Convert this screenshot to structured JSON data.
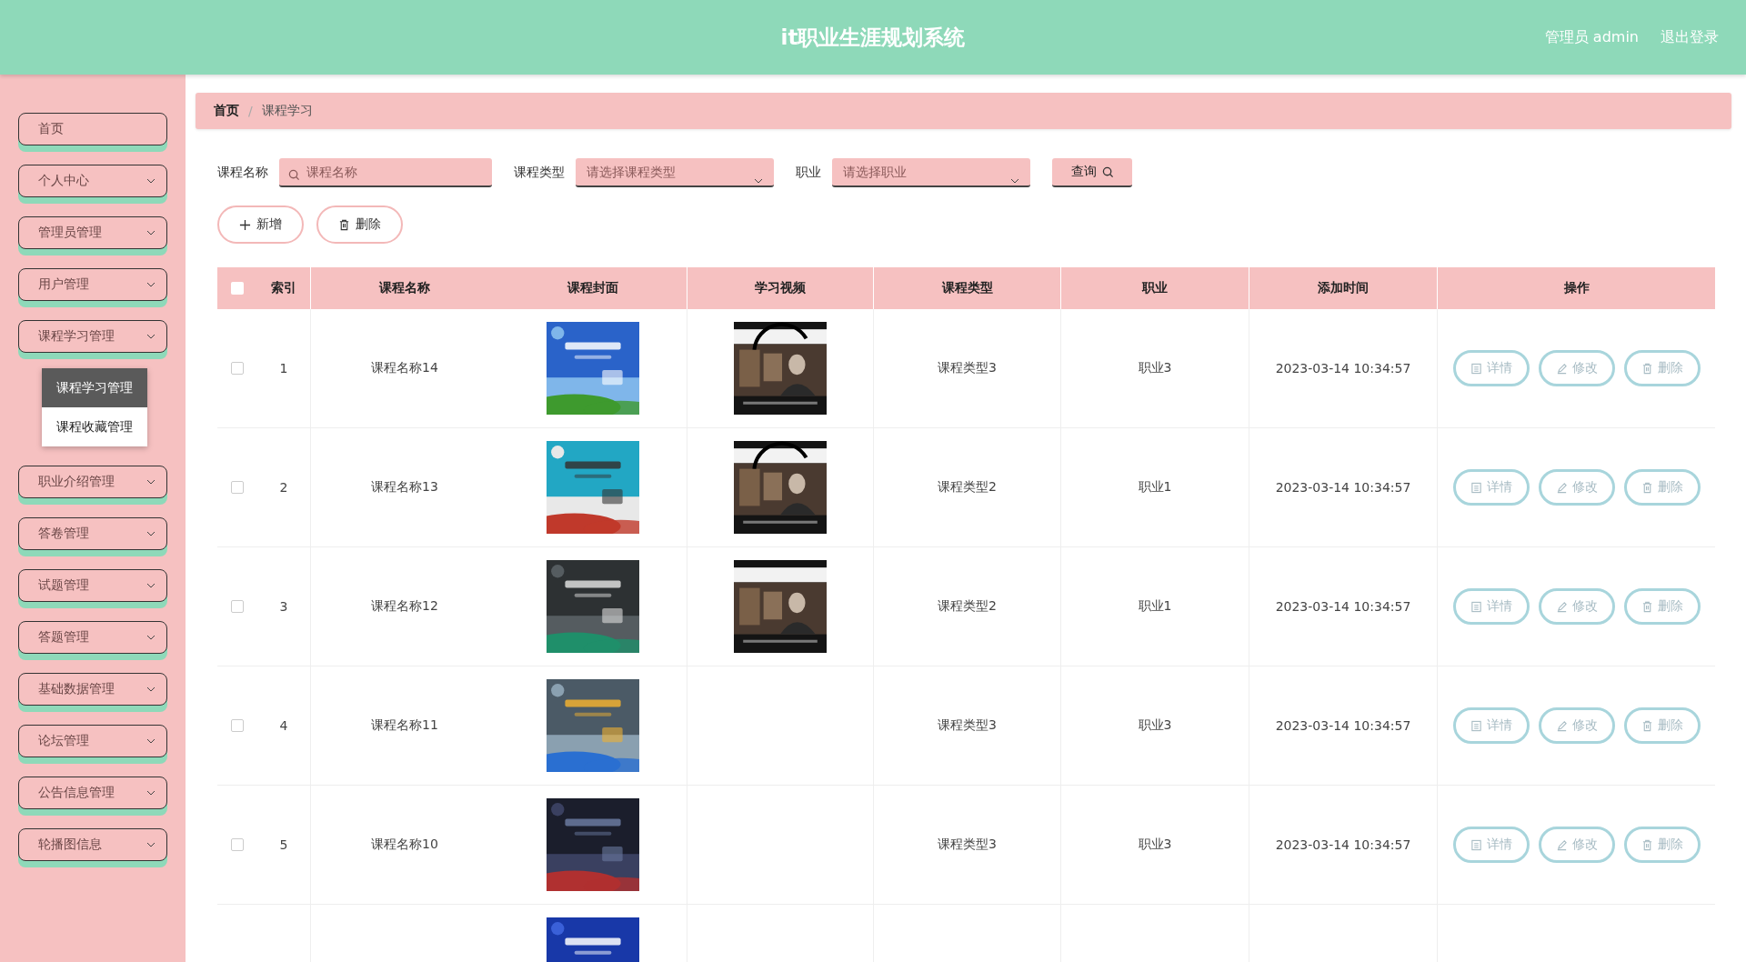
{
  "header": {
    "title": "it职业生涯规划系统",
    "user": "管理员 admin",
    "logout": "退出登录"
  },
  "sidebar": {
    "items": [
      {
        "label": "首页",
        "kind": "link"
      },
      {
        "label": "个人中心",
        "kind": "menu"
      },
      {
        "label": "管理员管理",
        "kind": "menu"
      },
      {
        "label": "用户管理",
        "kind": "menu"
      },
      {
        "label": "课程学习管理",
        "kind": "menu",
        "children": [
          {
            "label": "课程学习管理",
            "selected": true
          },
          {
            "label": "课程收藏管理",
            "selected": false
          }
        ]
      },
      {
        "label": "职业介绍管理",
        "kind": "menu"
      },
      {
        "label": "答卷管理",
        "kind": "menu"
      },
      {
        "label": "试题管理",
        "kind": "menu"
      },
      {
        "label": "答题管理",
        "kind": "menu"
      },
      {
        "label": "基础数据管理",
        "kind": "menu"
      },
      {
        "label": "论坛管理",
        "kind": "menu"
      },
      {
        "label": "公告信息管理",
        "kind": "menu"
      },
      {
        "label": "轮播图信息",
        "kind": "menu"
      }
    ]
  },
  "breadcrumb": {
    "separator": "/",
    "items": [
      {
        "label": "首页"
      },
      {
        "label": "课程学习"
      }
    ]
  },
  "search": {
    "fields": [
      {
        "label": "课程名称",
        "kind": "input",
        "placeholder": "课程名称"
      },
      {
        "label": "课程类型",
        "kind": "select",
        "placeholder": "请选择课程类型"
      },
      {
        "label": "职业",
        "kind": "select",
        "placeholder": "请选择职业"
      }
    ],
    "button": "查询"
  },
  "actions": [
    {
      "label": "新增",
      "kind": "add"
    },
    {
      "label": "删除",
      "kind": "delete"
    }
  ],
  "table": {
    "all_checked": false,
    "columns": [
      "索引",
      "课程名称",
      "课程封面",
      "学习视频",
      "课程类型",
      "职业",
      "添加时间",
      "操作"
    ],
    "rows": [
      {
        "checked": false,
        "index": "1",
        "name": "课程名称14",
        "cover": {
          "kind": "picture"
        },
        "video": {
          "kind": "picture"
        },
        "type": "课程类型3",
        "job": "职业3",
        "time": "2023-03-14 10:34:57",
        "actions": [
          {
            "label": "详情",
            "kind": "detail"
          },
          {
            "label": "修改",
            "kind": "edit"
          },
          {
            "label": "删除",
            "kind": "delete"
          }
        ]
      },
      {
        "checked": false,
        "index": "2",
        "name": "课程名称13",
        "cover": {
          "kind": "picture"
        },
        "video": {
          "kind": "picture"
        },
        "type": "课程类型2",
        "job": "职业1",
        "time": "2023-03-14 10:34:57",
        "actions": [
          {
            "label": "详情",
            "kind": "detail"
          },
          {
            "label": "修改",
            "kind": "edit"
          },
          {
            "label": "删除",
            "kind": "delete"
          }
        ]
      },
      {
        "checked": false,
        "index": "3",
        "name": "课程名称12",
        "cover": {
          "kind": "picture"
        },
        "video": {
          "kind": "picture"
        },
        "type": "课程类型2",
        "job": "职业1",
        "time": "2023-03-14 10:34:57",
        "actions": [
          {
            "label": "详情",
            "kind": "detail"
          },
          {
            "label": "修改",
            "kind": "edit"
          },
          {
            "label": "删除",
            "kind": "delete"
          }
        ]
      },
      {
        "checked": false,
        "index": "4",
        "name": "课程名称11",
        "cover": {
          "kind": "picture"
        },
        "type": "课程类型3",
        "job": "职业3",
        "time": "2023-03-14 10:34:57",
        "actions": [
          {
            "label": "详情",
            "kind": "detail"
          },
          {
            "label": "修改",
            "kind": "edit"
          },
          {
            "label": "删除",
            "kind": "delete"
          }
        ]
      },
      {
        "checked": false,
        "index": "5",
        "name": "课程名称10",
        "cover": {
          "kind": "picture"
        },
        "type": "课程类型3",
        "job": "职业3",
        "time": "2023-03-14 10:34:57",
        "actions": [
          {
            "label": "详情",
            "kind": "detail"
          },
          {
            "label": "修改",
            "kind": "edit"
          },
          {
            "label": "删除",
            "kind": "delete"
          }
        ]
      },
      {
        "cover": {
          "kind": "picture"
        }
      }
    ]
  }
}
